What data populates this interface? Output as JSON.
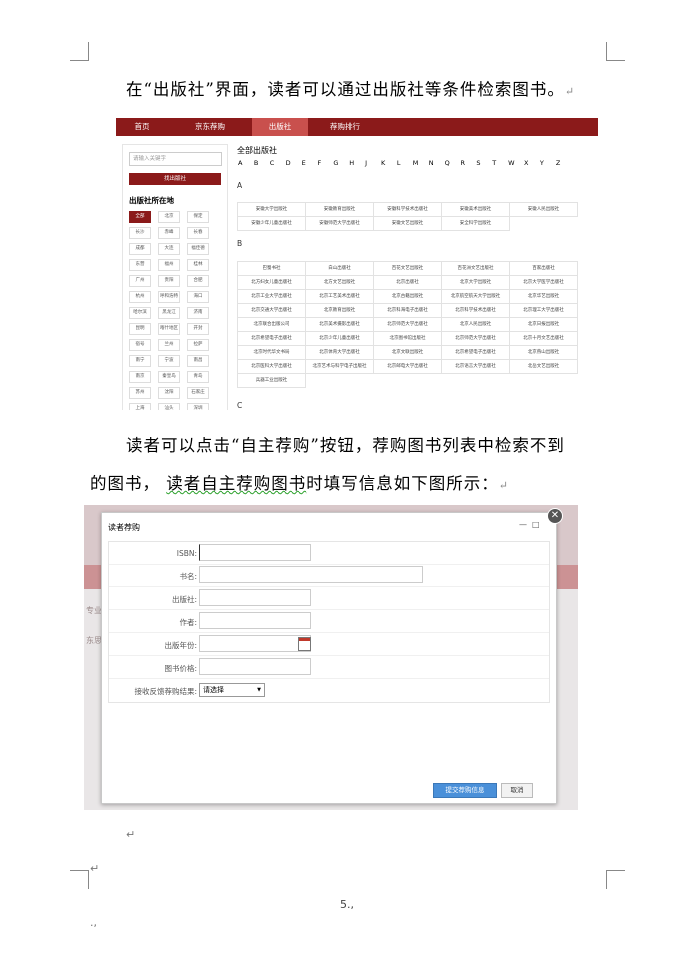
{
  "doc": {
    "para1": "在“出版社”界面，读者可以通过出版社等条件检索图书。",
    "para2": "读者可以点击“自主荐购”按钮，荐购图书列表中检索不到",
    "para3_pre": "的图书，",
    "para3_mid": "读者自主荐购图书",
    "para3_post": "时填写信息如下图所示：",
    "mark_return": "↵",
    "mark_ret2": "↵",
    "mark_ret3": "↵",
    "mark_ret4": "↵",
    "mark_ret5": "↵",
    "mark_dot": ".,",
    "page_number": "5.,"
  },
  "shot1": {
    "nav": [
      "首页",
      "京东荐购",
      "出版社",
      "荐购排行"
    ],
    "search_placeholder": "请输入关键字",
    "search_button": "找出版社",
    "side_title": "出版社所在地",
    "cities": [
      "全部",
      "北京",
      "保定",
      "长沙",
      "赤峰",
      "长春",
      "成都",
      "大连",
      "福佳德",
      "东营",
      "福州",
      "桂林",
      "广州",
      "贵阳",
      "合肥",
      "杭州",
      "呼和浩特",
      "海口",
      "哈尔滨",
      "黑龙江",
      "济南",
      "昆明",
      "喀什地区",
      "开封",
      "宿号",
      "兰州",
      "拉萨",
      "南宁",
      "宁波",
      "南昌",
      "南京",
      "秦皇岛",
      "青岛",
      "苏州",
      "沈阳",
      "石家庄",
      "上海",
      "汕头",
      "深圳",
      "天津",
      "太原",
      "通辽"
    ],
    "main_title": "全部出版社",
    "letters": [
      "A",
      "B",
      "C",
      "D",
      "E",
      "F",
      "G",
      "H",
      "J",
      "K",
      "L",
      "M",
      "N",
      "Q",
      "R",
      "S",
      "T",
      "W",
      "X",
      "Y",
      "Z"
    ],
    "section_a_label": "A",
    "section_a": [
      "安徽大学出版社",
      "安徽教育出版社",
      "安徽科学技术出版社",
      "安徽美术出版社",
      "安徽人民出版社",
      "安徽少年儿童出版社",
      "安徽师范大学出版社",
      "安徽文艺出版社",
      "安全科学出版社"
    ],
    "section_b_label": "B",
    "section_b": [
      "巴蜀书社",
      "白山出版社",
      "百花文艺出版社",
      "百花洲文艺出版社",
      "百家出版社",
      "北方妇女儿童出版社",
      "北方文艺出版社",
      "北京出版社",
      "北京大学出版社",
      "北京大学医学出版社",
      "北京工业大学出版社",
      "北京工艺美术出版社",
      "北京古籍出版社",
      "北京航空航天大学出版社",
      "北京华艺出版社",
      "北京交通大学出版社",
      "北京教育出版社",
      "北京科海电子出版社",
      "北京科学技术出版社",
      "北京理工大学出版社",
      "北京联合出版公司",
      "北京美术摄影出版社",
      "北京师范大学出版社",
      "北京人民出版社",
      "北京日报出版社",
      "北京希望电子出版社",
      "北京少年儿童出版社",
      "北京图书馆出版社",
      "北京师范大学出版社",
      "北京十月文艺出版社",
      "北京时代华文书局",
      "北京体育大学出版社",
      "北京文联出版社",
      "北京希望电子出版社",
      "北京燕山出版社",
      "北京医科大学出版社",
      "北京艺术与科学电子出版社",
      "北京邮电大学出版社",
      "北京语言大学出版社",
      "北岳文艺出版社",
      "兵器工业出版社"
    ],
    "section_c_label": "C"
  },
  "shot2": {
    "dialog_title": "读者荐购",
    "ctrl_min": "—",
    "ctrl_max": "□",
    "close_glyph": "✕",
    "labels": [
      "ISBN:",
      "书名:",
      "出版社:",
      "作者:",
      "出版年份:",
      "图书价格:",
      "接收反馈荐购结果:"
    ],
    "select_value": "请选择",
    "select_arrow": "▼",
    "submit": "提交荐购信息",
    "cancel": "取消",
    "bg_text_1": "专业",
    "bg_text_2": "东思想"
  }
}
